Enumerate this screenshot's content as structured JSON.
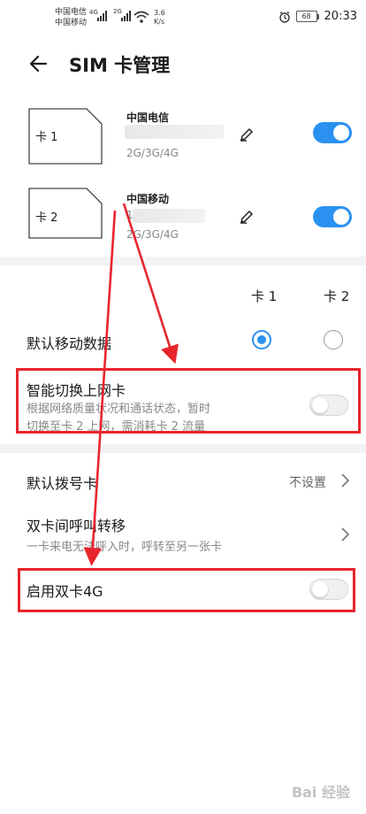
{
  "status_bar": {
    "carrier1": "中国电信",
    "carrier2": "中国移动",
    "net1": "4G",
    "net2": "2G",
    "speed_value": "3.6",
    "speed_unit": "K/s",
    "battery": "68",
    "time": "20:33"
  },
  "header": {
    "title": "SIM 卡管理"
  },
  "sims": [
    {
      "slot_label": "卡 1",
      "carrier": "中国电信",
      "network": "2G/3G/4G",
      "enabled": true
    },
    {
      "slot_label": "卡 2",
      "carrier": "中国移动",
      "number_prefix": "1",
      "network": "2G/3G/4G",
      "enabled": true
    }
  ],
  "columns": {
    "card1": "卡 1",
    "card2": "卡 2"
  },
  "default_data": {
    "label": "默认移动数据",
    "selected": "card1"
  },
  "smart_switch": {
    "title": "智能切换上网卡",
    "desc_line1": "根据网络质量状况和通话状态，暂时",
    "desc_line2": "切换至卡 2 上网，需消耗卡 2 流量",
    "enabled": false
  },
  "default_dial": {
    "label": "默认拨号卡",
    "value": "不设置"
  },
  "call_forward": {
    "title": "双卡间呼叫转移",
    "desc": "一卡来电无法呼入时，呼转至另一张卡"
  },
  "dual_4g": {
    "label": "启用双卡4G",
    "enabled": false
  },
  "watermark": "Bai 经验",
  "colors": {
    "accent": "#2a91f0",
    "annotation": "#e8252d"
  }
}
